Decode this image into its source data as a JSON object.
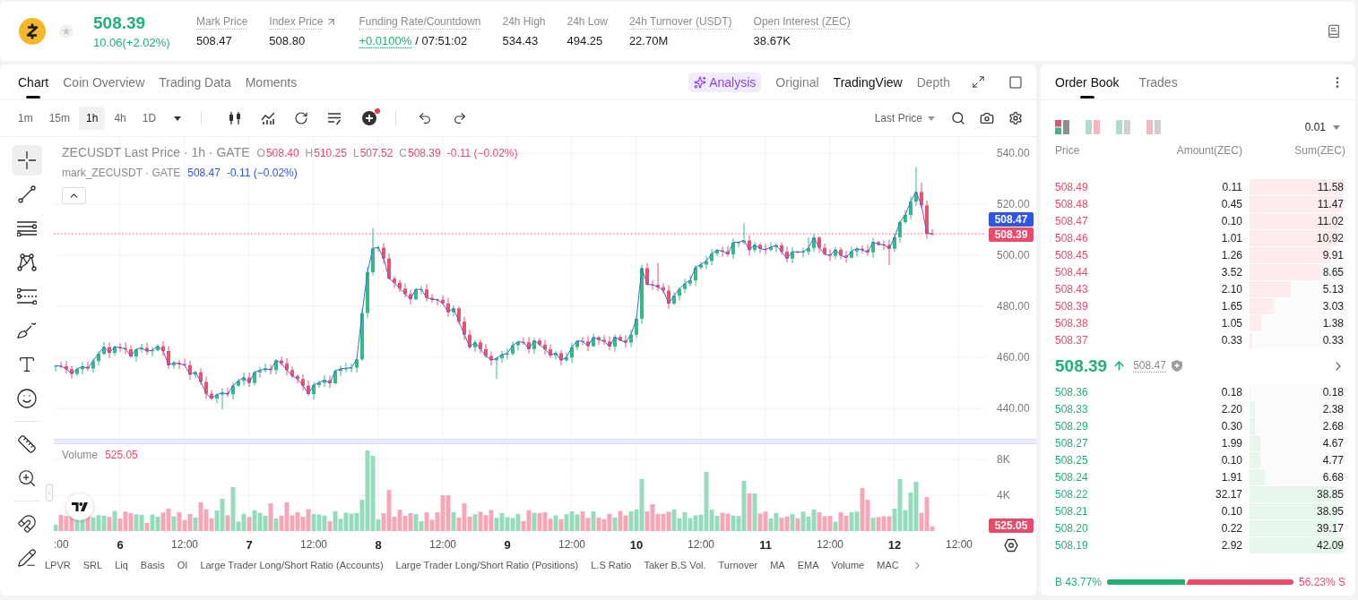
{
  "ticker": {
    "price": "508.39",
    "change": "10.06(+2.02%)",
    "rising": true,
    "favorite": false
  },
  "stats": [
    {
      "kind": "plain",
      "label": "Mark Price",
      "value": "508.47",
      "has_tip": true
    },
    {
      "kind": "linked",
      "label": "Index Price",
      "value": "508.80",
      "has_tip": true
    },
    {
      "kind": "funding",
      "label": "Funding Rate/Countdown",
      "rate": "+0.0100%",
      "countdown": "/ 07:51:02",
      "has_tip": true
    },
    {
      "kind": "plain",
      "label": "24h High",
      "value": "534.43",
      "has_tip": false
    },
    {
      "kind": "plain",
      "label": "24h Low",
      "value": "494.25",
      "has_tip": false
    },
    {
      "kind": "plain",
      "label": "24h Turnover (USDT)",
      "value": "22.70M",
      "has_tip": true
    },
    {
      "kind": "plain",
      "label": "Open Interest (ZEC)",
      "value": "38.67K",
      "has_tip": true
    }
  ],
  "chart_tabs": [
    {
      "label": "Chart",
      "selected": true
    },
    {
      "label": "Coin Overview",
      "selected": false
    },
    {
      "label": "Trading Data",
      "selected": false
    },
    {
      "label": "Moments",
      "selected": false
    }
  ],
  "analysis": {
    "label": "Analysis"
  },
  "chart_views": [
    {
      "label": "Original",
      "selected": false
    },
    {
      "label": "TradingView",
      "selected": true
    },
    {
      "label": "Depth",
      "selected": false
    }
  ],
  "intervals": [
    {
      "label": "1m",
      "selected": false
    },
    {
      "label": "15m",
      "selected": false
    },
    {
      "label": "1h",
      "selected": true
    },
    {
      "label": "4h",
      "selected": false
    },
    {
      "label": "1D",
      "selected": false
    }
  ],
  "price_source": "Last Price",
  "drawing_tool_groups": [
    [
      {
        "kind": "crosshair",
        "selected": true
      },
      {
        "kind": "trend_line",
        "selected": false
      },
      {
        "kind": "parallel_lines",
        "selected": false
      },
      {
        "kind": "pattern",
        "selected": false
      },
      {
        "kind": "levels",
        "selected": false
      },
      {
        "kind": "brush",
        "selected": false
      },
      {
        "kind": "text",
        "selected": false
      },
      {
        "kind": "emoji",
        "selected": false
      }
    ],
    [
      {
        "kind": "ruler",
        "selected": false
      },
      {
        "kind": "zoom",
        "selected": false
      }
    ],
    [
      {
        "kind": "magnet",
        "selected": false
      },
      {
        "kind": "pencil",
        "selected": false
      }
    ]
  ],
  "legend": {
    "symbol": "ZECUSDT Last Price · 1h · GATE",
    "rising": false,
    "ohlc": [
      {
        "key": "O",
        "value": "508.40"
      },
      {
        "key": "H",
        "value": "510.25"
      },
      {
        "key": "L",
        "value": "507.52"
      },
      {
        "key": "C",
        "value": "508.39"
      }
    ],
    "change": "-0.11 (−0.02%)",
    "mark_series": "mark_ZECUSDT · GATE",
    "mark_value": "508.47",
    "mark_change": "-0.11 (−0.02%)",
    "collapsed": false
  },
  "price_axis": {
    "ticks": [
      "540.00",
      "520.00",
      "500.00",
      "480.00",
      "460.00",
      "440.00"
    ],
    "mark_price": "508.47",
    "last_price": "508.39"
  },
  "volume": {
    "label": "Volume",
    "value": "525.05",
    "ticks": [
      "8K",
      "4K"
    ],
    "last": "525.05"
  },
  "time_axis": [
    {
      "label": ":00",
      "major": false
    },
    {
      "label": "6",
      "major": true
    },
    {
      "label": "12:00",
      "major": false
    },
    {
      "label": "7",
      "major": true
    },
    {
      "label": "12:00",
      "major": false
    },
    {
      "label": "8",
      "major": true
    },
    {
      "label": "12:00",
      "major": false
    },
    {
      "label": "9",
      "major": true
    },
    {
      "label": "12:00",
      "major": false
    },
    {
      "label": "10",
      "major": true
    },
    {
      "label": "12:00",
      "major": false
    },
    {
      "label": "11",
      "major": true
    },
    {
      "label": "12:00",
      "major": false
    },
    {
      "label": "12",
      "major": true
    },
    {
      "label": "12:00",
      "major": false
    }
  ],
  "indicator_tabs": [
    "LPVR",
    "SRL",
    "Liq",
    "Basis",
    "OI",
    "Large Trader Long/Short Ratio (Accounts)",
    "Large Trader Long/Short Ratio (Positions)",
    "L.S Ratio",
    "Taker B.S Vol.",
    "Turnover",
    "MA",
    "EMA",
    "Volume",
    "MAC"
  ],
  "order_book": {
    "tabs": [
      {
        "label": "Order Book",
        "selected": true
      },
      {
        "label": "Trades",
        "selected": false
      }
    ],
    "layouts": [
      {
        "kind": "split",
        "selected": true
      },
      {
        "kind": "side_by_side",
        "selected": false
      },
      {
        "kind": "bids",
        "selected": false
      },
      {
        "kind": "asks",
        "selected": false
      }
    ],
    "precision": "0.01",
    "columns": [
      "Price",
      "Amount(ZEC)",
      "Sum(ZEC)"
    ],
    "asks": [
      {
        "price": "508.49",
        "amount": "0.11",
        "sum": "11.58",
        "level": 1.0
      },
      {
        "price": "508.48",
        "amount": "0.45",
        "sum": "11.47",
        "level": 0.99
      },
      {
        "price": "508.47",
        "amount": "0.10",
        "sum": "11.02",
        "level": 0.95
      },
      {
        "price": "508.46",
        "amount": "1.01",
        "sum": "10.92",
        "level": 0.94
      },
      {
        "price": "508.45",
        "amount": "1.26",
        "sum": "9.91",
        "level": 0.86
      },
      {
        "price": "508.44",
        "amount": "3.52",
        "sum": "8.65",
        "level": 0.75
      },
      {
        "price": "508.43",
        "amount": "2.10",
        "sum": "5.13",
        "level": 0.44
      },
      {
        "price": "508.39",
        "amount": "1.65",
        "sum": "3.03",
        "level": 0.26
      },
      {
        "price": "508.38",
        "amount": "1.05",
        "sum": "1.38",
        "level": 0.12
      },
      {
        "price": "508.37",
        "amount": "0.33",
        "sum": "0.33",
        "level": 0.03
      }
    ],
    "last_price": "508.39",
    "rising": true,
    "mark_price": "508.47",
    "bids": [
      {
        "price": "508.36",
        "amount": "0.18",
        "sum": "0.18",
        "level": 0.01
      },
      {
        "price": "508.33",
        "amount": "2.20",
        "sum": "2.38",
        "level": 0.06
      },
      {
        "price": "508.29",
        "amount": "0.30",
        "sum": "2.68",
        "level": 0.06
      },
      {
        "price": "508.27",
        "amount": "1.99",
        "sum": "4.67",
        "level": 0.11
      },
      {
        "price": "508.25",
        "amount": "0.10",
        "sum": "4.77",
        "level": 0.11
      },
      {
        "price": "508.24",
        "amount": "1.91",
        "sum": "6.68",
        "level": 0.16
      },
      {
        "price": "508.22",
        "amount": "32.17",
        "sum": "38.85",
        "level": 0.92
      },
      {
        "price": "508.21",
        "amount": "0.10",
        "sum": "38.95",
        "level": 0.93
      },
      {
        "price": "508.20",
        "amount": "0.22",
        "sum": "39.17",
        "level": 0.93
      },
      {
        "price": "508.19",
        "amount": "2.92",
        "sum": "42.09",
        "level": 1.0
      }
    ],
    "ratio": {
      "buy": "B 43.77%",
      "sell": "56.23% S",
      "level": 0.4377
    }
  }
}
